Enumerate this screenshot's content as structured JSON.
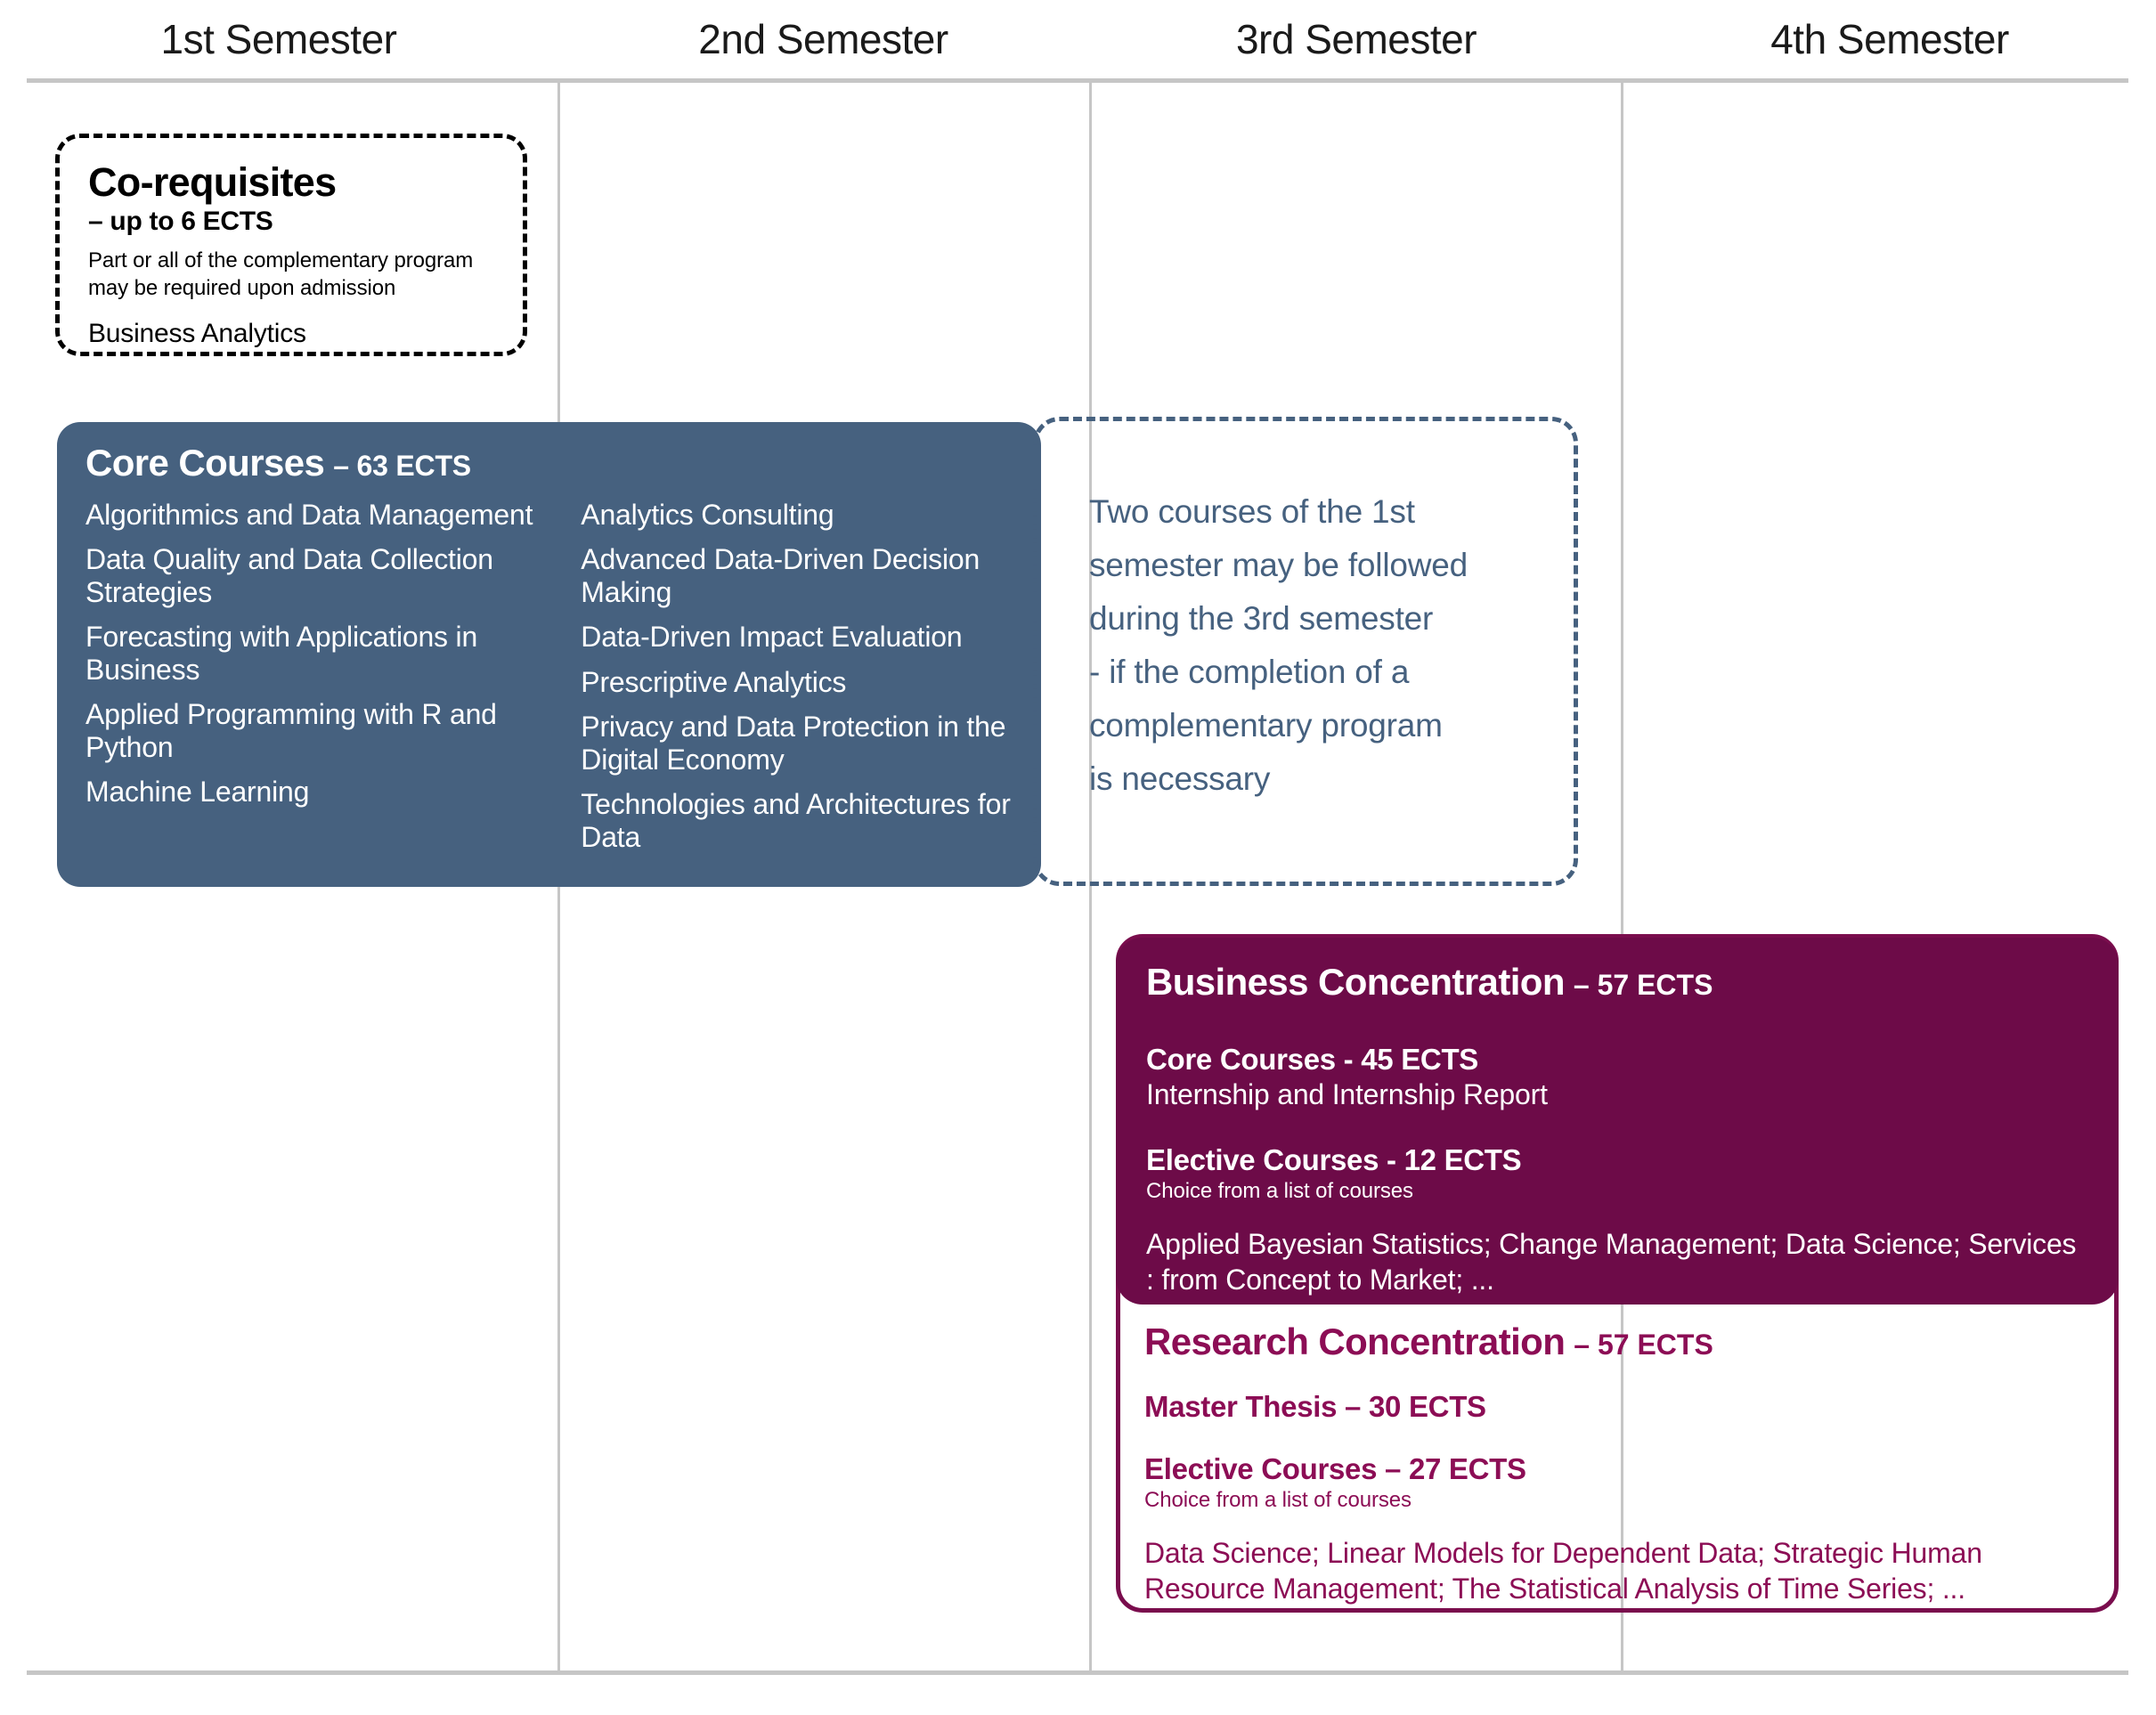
{
  "colors": {
    "blue": "#46617f",
    "maroon_fill": "#6d0b48",
    "maroon_text": "#8c0d55",
    "grid_line": "#c6c6c6",
    "black": "#000000",
    "white": "#ffffff"
  },
  "header": {
    "semesters": [
      {
        "label": "1st Semester"
      },
      {
        "label": "2nd Semester"
      },
      {
        "label": "3rd Semester"
      },
      {
        "label": "4th Semester"
      }
    ]
  },
  "corequisites": {
    "title": "Co-requisites",
    "ects": "– up to 6 ECTS",
    "note": "Part or all of the complementary program may be required upon admission",
    "item": "Business Analytics"
  },
  "core_courses": {
    "title": "Core Courses",
    "ects": "– 63 ECTS",
    "column_1": [
      "Algorithmics and Data Management",
      "Data Quality and Data Collection Strategies",
      "Forecasting with Applications in Business",
      "Applied Programming with R and Python",
      "Machine Learning"
    ],
    "column_2": [
      "Analytics Consulting",
      "Advanced Data-Driven Decision Making",
      "Data-Driven Impact Evaluation",
      "Prescriptive Analytics",
      "Privacy and Data Protection in the Digital Economy",
      "Technologies and Architectures for Data"
    ]
  },
  "note_box": {
    "lines": [
      "Two courses of the 1st",
      "semester may be followed",
      "during the 3rd semester",
      "- if the completion of a",
      "complementary program",
      "is necessary"
    ]
  },
  "business_concentration": {
    "title": "Business Concentration",
    "ects": "– 57 ECTS",
    "core": {
      "heading": "Core Courses - 45 ECTS",
      "item": "Internship and Internship Report"
    },
    "elective": {
      "heading": "Elective Courses  - 12 ECTS",
      "note": "Choice from a list of courses",
      "list": "Applied Bayesian Statistics; Change Management; Data Science; Services : from Concept to Market; ..."
    }
  },
  "research_concentration": {
    "title": "Research Concentration",
    "ects": "– 57 ECTS",
    "thesis": {
      "heading": "Master Thesis – 30 ECTS"
    },
    "elective": {
      "heading": "Elective Courses – 27 ECTS",
      "note": "Choice from a list of courses",
      "list": "Data Science; Linear Models for Dependent Data; Strategic Human Resource Management; The Statistical Analysis of Time Series; ..."
    }
  }
}
